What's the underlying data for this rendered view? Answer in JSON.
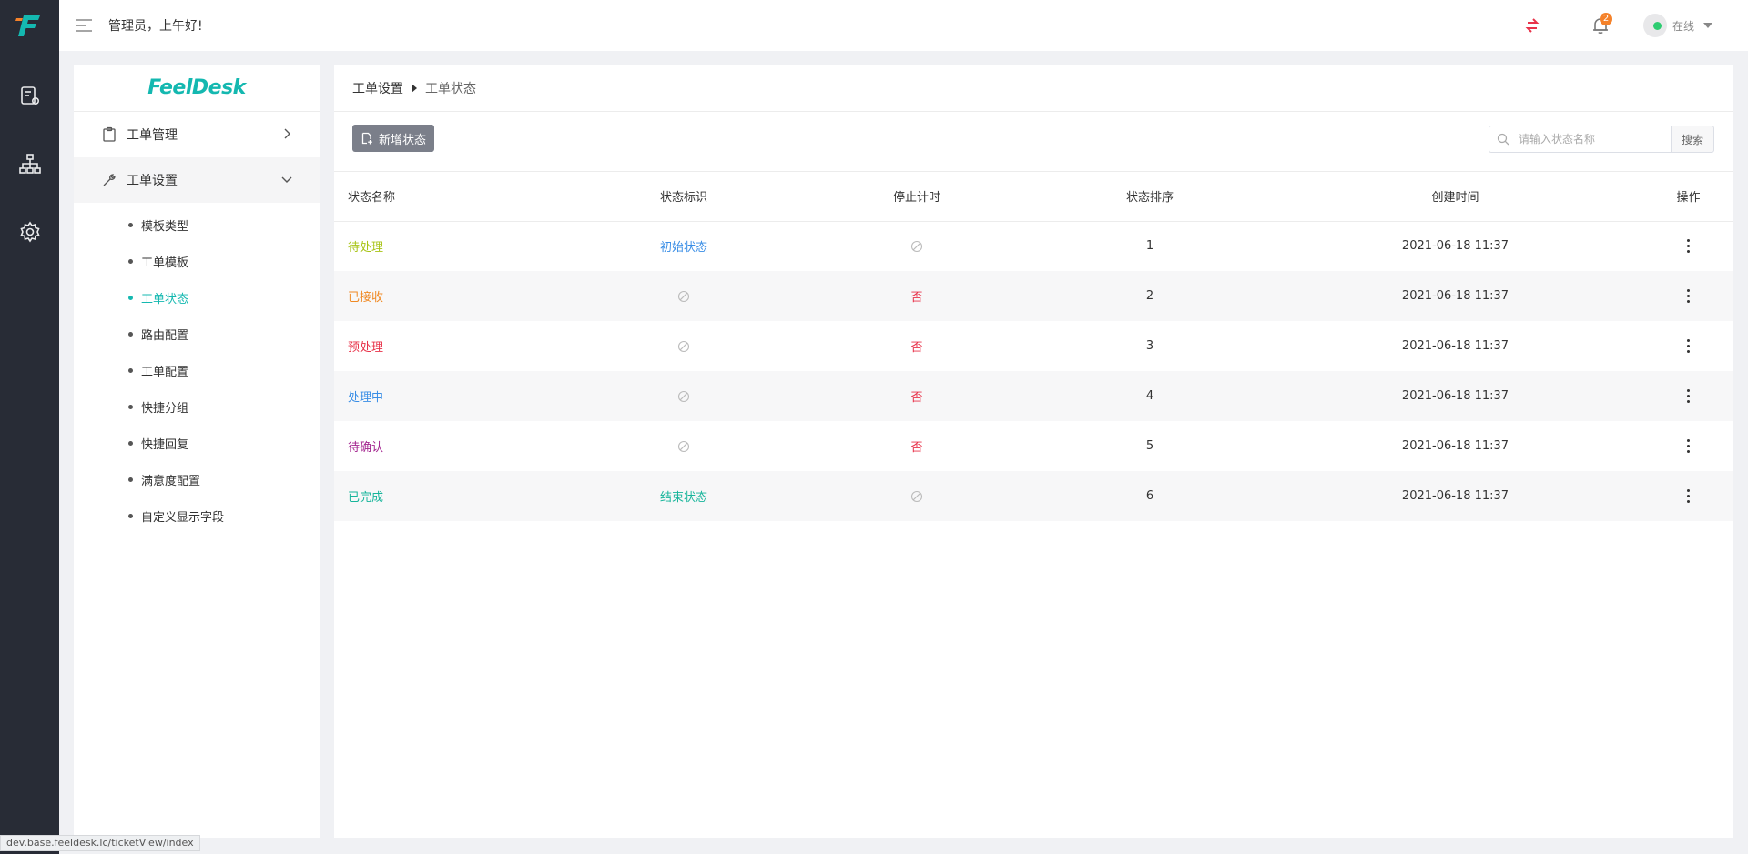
{
  "topbar": {
    "greeting": "管理员，上午好!",
    "notification_count": "2",
    "status_label": "在线"
  },
  "sidebar": {
    "brand": "FeelDesk",
    "groups": [
      {
        "label": "工单管理",
        "icon": "clipboard-icon",
        "expanded": false
      },
      {
        "label": "工单设置",
        "icon": "wrench-icon",
        "expanded": true
      }
    ],
    "sub_items": [
      "模板类型",
      "工单模板",
      "工单状态",
      "路由配置",
      "工单配置",
      "快捷分组",
      "快捷回复",
      "满意度配置",
      "自定义显示字段"
    ],
    "active_sub_item": "工单状态"
  },
  "breadcrumb": {
    "parent": "工单设置",
    "current": "工单状态"
  },
  "toolbar": {
    "add_label": "新增状态",
    "search_placeholder": "请输入状态名称",
    "search_button": "搜索"
  },
  "table": {
    "headers": [
      "状态名称",
      "状态标识",
      "停止计时",
      "状态排序",
      "创建时间",
      "操作"
    ],
    "rows": [
      {
        "name": "待处理",
        "name_color": "#a8c417",
        "flag": "初始状态",
        "stop": "",
        "order": "1",
        "created": "2021-06-18 11:37"
      },
      {
        "name": "已接收",
        "name_color": "#f08a24",
        "flag": "",
        "stop": "否",
        "order": "2",
        "created": "2021-06-18 11:37"
      },
      {
        "name": "预处理",
        "name_color": "#e8334a",
        "flag": "",
        "stop": "否",
        "order": "3",
        "created": "2021-06-18 11:37"
      },
      {
        "name": "处理中",
        "name_color": "#3a8ee6",
        "flag": "",
        "stop": "否",
        "order": "4",
        "created": "2021-06-18 11:37"
      },
      {
        "name": "待确认",
        "name_color": "#a3258f",
        "flag": "",
        "stop": "否",
        "order": "5",
        "created": "2021-06-18 11:37"
      },
      {
        "name": "已完成",
        "name_color": "#17b59b",
        "flag": "结束状态",
        "stop": "",
        "order": "6",
        "created": "2021-06-18 11:37"
      }
    ]
  },
  "statusbar": {
    "url": "dev.base.feeldesk.lc/ticketView/index"
  },
  "colors": {
    "rail_bg": "#282c36",
    "accent": "#14b8b0",
    "negative": "#e8334a"
  }
}
